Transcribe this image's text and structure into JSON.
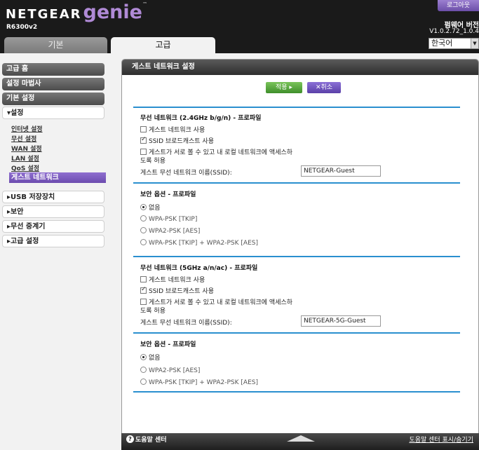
{
  "header": {
    "brand": "NETGEAR",
    "product": "genie",
    "tm": "™",
    "model": "R6300v2",
    "logout_label": "로그아웃",
    "firmware_title": "펌웨어 버전",
    "firmware_version": "V1.0.2.72_1.0.4",
    "language": "한국어"
  },
  "tabs": {
    "basic": "기본",
    "advanced": "고급"
  },
  "sidebar": {
    "advanced_home": "고급 홈",
    "setup_wizard": "설정 마법사",
    "basic_setup": "기본 설정",
    "setup": "▾설정",
    "sub": {
      "internet": "인터넷 설정",
      "wireless": "무선 설정",
      "wan": "WAN 설정",
      "lan": "LAN 설정",
      "qos": "QoS 설정",
      "guest": "게스트 네트워크"
    },
    "usb": "▸USB 저장장치",
    "security": "▸보안",
    "repeater": "▸무선 중계기",
    "advanced_setup": "▸고급 설정"
  },
  "panel": {
    "title": "게스트 네트워크 설정",
    "apply": "적용 ▸",
    "cancel": "✕취소",
    "band24": {
      "title": "무선 네트워크 (2.4GHz b/g/n) - 프로파일",
      "enable_guest": "게스트 네트워크 사용",
      "enable_guest_checked": false,
      "ssid_broadcast": "SSID 브로드캐스트 사용",
      "ssid_broadcast_checked": true,
      "allow_access_line1": "게스트가 서로 볼 수 있고 내 로컬 네트워크에 액세스하",
      "allow_access_line2": "도록 허용",
      "allow_access_checked": false,
      "ssid_label": "게스트 무선 네트워크 이름(SSID):",
      "ssid_value": "NETGEAR-Guest"
    },
    "sec24": {
      "title": "보안 옵션 - 프로파일",
      "opt_none": "없음",
      "opt_wpa_tkip": "WPA-PSK [TKIP]",
      "opt_wpa2_aes": "WPA2-PSK [AES]",
      "opt_mixed": "WPA-PSK [TKIP] + WPA2-PSK [AES]",
      "selected": "없음"
    },
    "band5": {
      "title": "무선 네트워크 (5GHz a/n/ac) - 프로파일",
      "enable_guest": "게스트 네트워크 사용",
      "enable_guest_checked": false,
      "ssid_broadcast": "SSID 브로드캐스트 사용",
      "ssid_broadcast_checked": true,
      "allow_access_line1": "게스트가 서로 볼 수 있고 내 로컬 네트워크에 액세스하",
      "allow_access_line2": "도록 허용",
      "allow_access_checked": false,
      "ssid_label": "게스트 무선 네트워크 이름(SSID):",
      "ssid_value": "NETGEAR-5G-Guest"
    },
    "sec5": {
      "title": "보안 옵션 - 프로파일",
      "opt_none": "없음",
      "opt_wpa2_aes": "WPA2-PSK [AES]",
      "opt_mixed": "WPA-PSK [TKIP] + WPA2-PSK [AES]",
      "selected": "없음"
    }
  },
  "footer": {
    "help_icon": "?",
    "help_center": "도움말 센터",
    "toggle_help": "도움말 센터 표시/숨기기"
  },
  "colors": {
    "accent_purple": "#7b5cc4",
    "separator_blue": "#2a8fcf",
    "apply_green": "#4fa034"
  }
}
